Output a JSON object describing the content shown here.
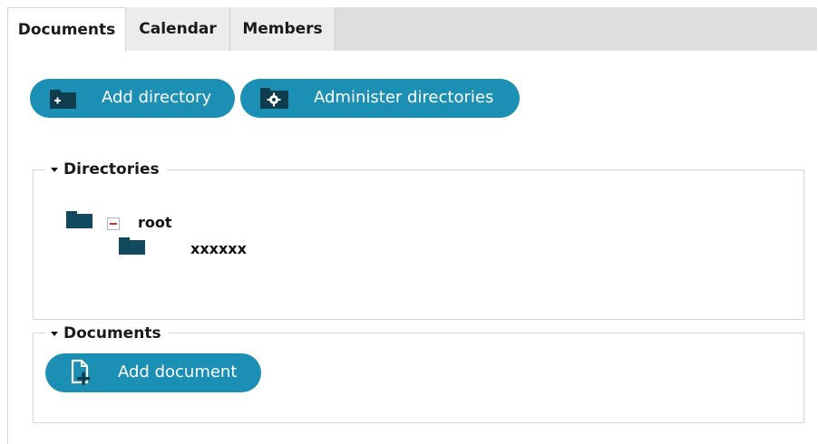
{
  "tabs": [
    {
      "label": "Documents",
      "active": true
    },
    {
      "label": "Calendar",
      "active": false
    },
    {
      "label": "Members",
      "active": false
    }
  ],
  "toolbar": {
    "add_directory_label": "Add directory",
    "administer_directories_label": "Administer directories",
    "add_directory_icon": "folder-add-icon",
    "administer_directories_icon": "folder-gear-icon"
  },
  "directories_section": {
    "legend": "Directories",
    "tree": {
      "root_label": "root",
      "root_expanded": true,
      "children": [
        {
          "label": "xxxxxx"
        }
      ]
    }
  },
  "documents_section": {
    "legend": "Documents",
    "add_document_label": "Add document",
    "add_document_icon": "document-add-icon"
  },
  "colors": {
    "button_bg": "#1c8fb5",
    "folder": "#114a5e",
    "tab_strip": "#dedede",
    "collapse_minus": "#c0392b"
  }
}
